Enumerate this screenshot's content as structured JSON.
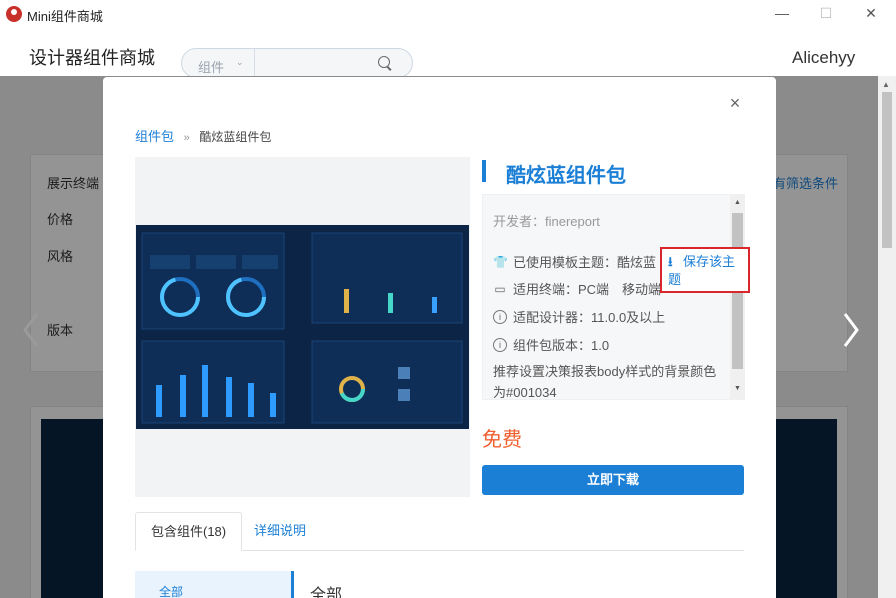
{
  "window": {
    "title": "Mini组件商城",
    "minimize": "—",
    "maximize": "☐",
    "close": "✕"
  },
  "header": {
    "store_title": "设计器组件商城",
    "search_category": "组件",
    "search_placeholder": "",
    "username": "Alicehyy"
  },
  "background": {
    "filters": [
      "展示终端",
      "价格",
      "风格",
      "版本"
    ],
    "filter_link": "有筛选条件"
  },
  "modal": {
    "close": "×",
    "breadcrumb": {
      "parent": "组件包",
      "separator": "»",
      "current": "酷炫蓝组件包"
    },
    "title": "酷炫蓝组件包",
    "developer": "开发者：finereport",
    "theme": "已使用模板主题：酷炫蓝",
    "terminal": "适用终端：PC端　移动端",
    "designer": "适配设计器：11.0.0及以上",
    "version": "组件包版本：1.0",
    "description": "推荐设置决策报表body样式的背景颜色为#001034",
    "save_theme": "保存该主题",
    "price": "免费",
    "download": "立即下载",
    "tabs": [
      {
        "label": "包含组件(18)"
      },
      {
        "label": "详细说明"
      }
    ],
    "category_all": "全部",
    "category_title": "全部"
  },
  "colors": {
    "accent": "#1c7fd6",
    "price": "#f06030",
    "highlight_border": "#d9262c",
    "dashboard_bg": "#0c2446"
  }
}
